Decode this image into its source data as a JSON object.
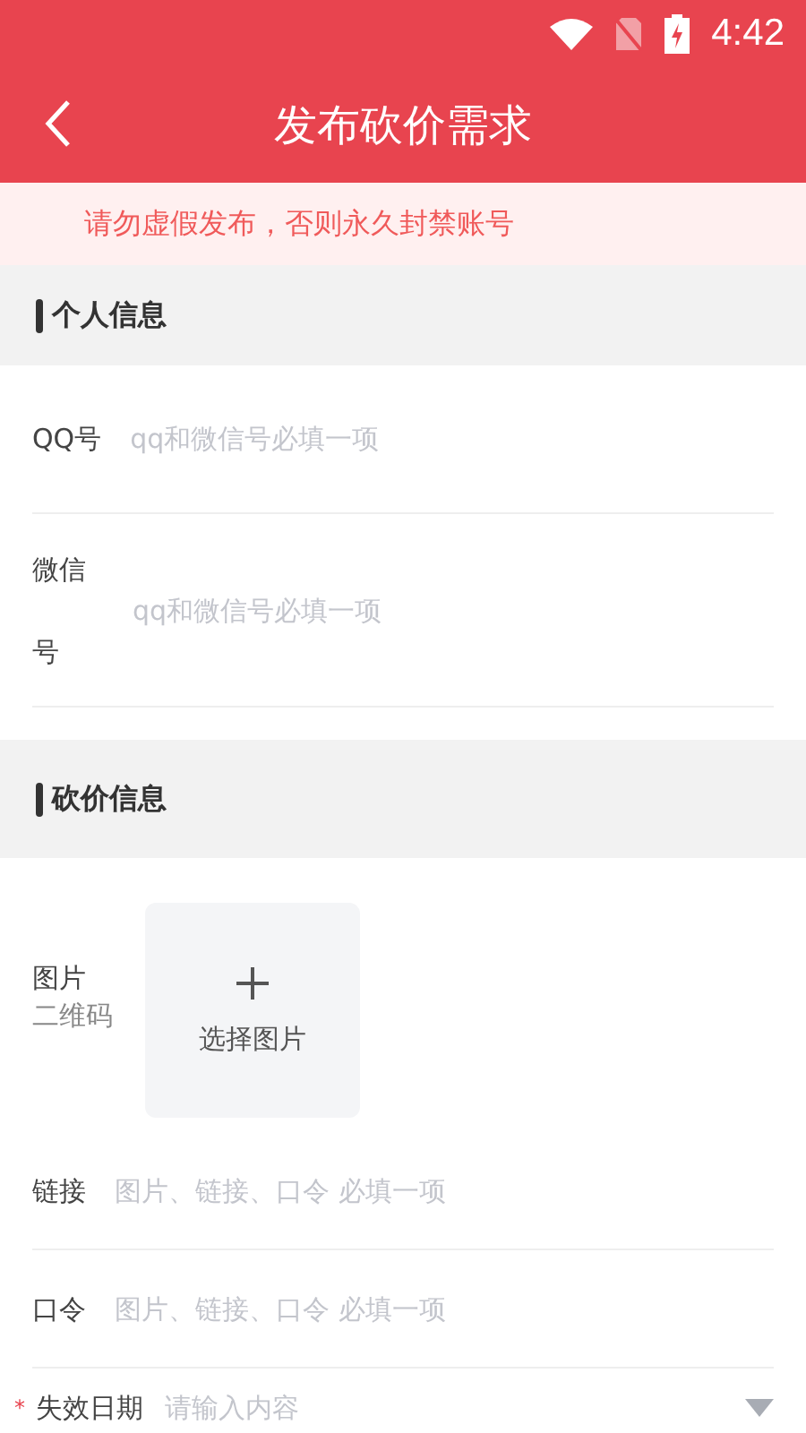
{
  "status_bar": {
    "time": "4:42"
  },
  "header": {
    "title": "发布砍价需求"
  },
  "notice": "请勿虚假发布，否则永久封禁账号",
  "sections": [
    {
      "title": "个人信息",
      "fields": [
        {
          "kind": "text",
          "label": "QQ号",
          "placeholder": "qq和微信号必填一项"
        },
        {
          "kind": "text",
          "label": "微信号",
          "placeholder": "qq和微信号必填一项"
        }
      ]
    },
    {
      "title": "砍价信息",
      "fields": [
        {
          "kind": "image",
          "label": "图片",
          "sublabel": "二维码",
          "button": "选择图片"
        },
        {
          "kind": "text",
          "label": "链接",
          "placeholder": "图片、链接、口令 必填一项"
        },
        {
          "kind": "text",
          "label": "口令",
          "placeholder": "图片、链接、口令 必填一项"
        },
        {
          "kind": "select",
          "required_mark": "*",
          "label": "失效日期",
          "placeholder": "请输入内容"
        }
      ]
    }
  ]
}
